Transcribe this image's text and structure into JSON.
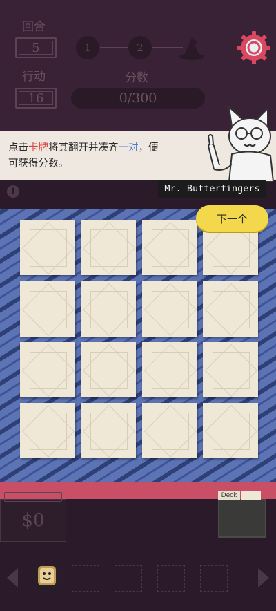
{
  "stats": {
    "round_label": "回合",
    "round_value": "5",
    "moves_label": "行动",
    "moves_value": "16",
    "score_label": "分数",
    "score_value": "0/300"
  },
  "stages": [
    "1",
    "2"
  ],
  "dialog": {
    "text_a": "点击",
    "text_card": "卡牌",
    "text_b": "将其翻开并凑齐",
    "text_pair": "一对",
    "text_c": "，便",
    "line2": "可获得分数。"
  },
  "speaker": "Mr. Butterfingers",
  "info_icon": "i",
  "next_button": "下一个",
  "cards": [
    "card-back",
    "card-back",
    "card-back",
    "card-back",
    "card-back",
    "card-back",
    "card-back",
    "card-back",
    "card-back",
    "card-back",
    "card-back",
    "card-back",
    "card-back",
    "card-back",
    "card-back",
    "card-back"
  ],
  "money": "$0",
  "deck_label": "Deck",
  "colors": {
    "accent_pink": "#c84f66",
    "button_yellow": "#f2d84a",
    "board_blue": "#5d74b4",
    "gear_red": "#d84860"
  }
}
